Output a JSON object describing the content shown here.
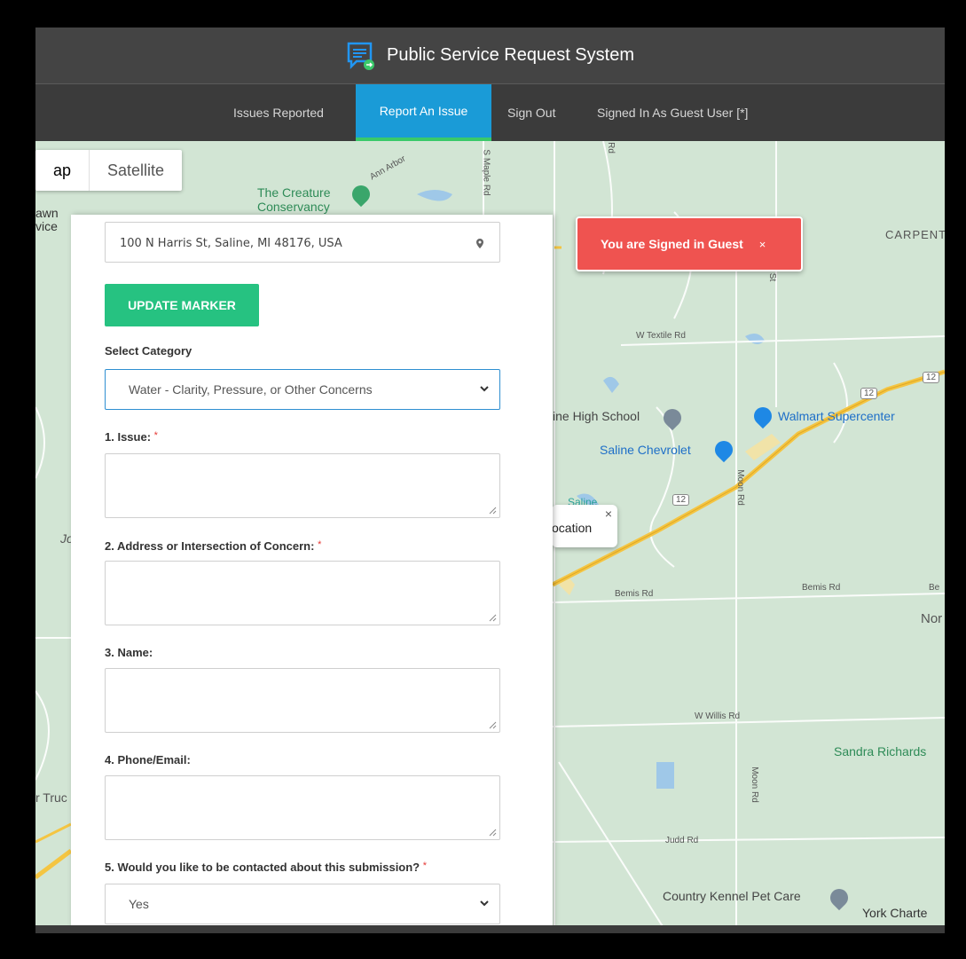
{
  "header": {
    "title": "Public Service Request System"
  },
  "nav": {
    "items": [
      {
        "label": "Issues Reported",
        "active": false
      },
      {
        "label": "Report An Issue",
        "active": true
      },
      {
        "label": "Sign Out",
        "active": false
      },
      {
        "label": "Signed In As Guest User [*]",
        "active": false
      }
    ]
  },
  "map": {
    "map_type": {
      "map": "ap",
      "satellite": "Satellite"
    },
    "labels": {
      "creature": "The Creature\nConservancy",
      "lawn": "awn",
      "vice": "vice",
      "carpenter": "CARPENT",
      "high_school": "ine High School",
      "walmart": "Walmart Supercenter",
      "chevrolet": "Saline Chevrolet",
      "joa": "Joa",
      "nor": "Nor",
      "sandra": "Sandra Richards",
      "truck": "r Truc",
      "kennel": "Country Kennel Pet Care",
      "york": "York Charte",
      "saline_small": "Saline"
    },
    "roads": {
      "ann_arbor": "Ann Arbor",
      "maple": "S Maple Rd",
      "w_textile": "W Textile Rd",
      "moon": "Moon Rd",
      "moon2": "Moon Rd",
      "bemis": "Bemis Rd",
      "bemis2": "Bemis Rd",
      "be": "Be",
      "willis": "W Willis Rd",
      "judd": "Judd Rd",
      "st": "St",
      "rd": "Rd",
      "r12a": "12",
      "r12b": "12",
      "r12c": "12"
    },
    "info_window": {
      "text": "ocation",
      "close": "×"
    }
  },
  "toast": {
    "message": "You are Signed in Guest",
    "close": "×"
  },
  "form": {
    "address_value": "100 N Harris St, Saline, MI 48176, USA",
    "update_button": "UPDATE MARKER",
    "category_label": "Select Category",
    "category_value": "Water - Clarity, Pressure, or Other Concerns",
    "issue_label": "1. Issue:",
    "address_label": "2. Address or Intersection of Concern:",
    "name_label": "3. Name:",
    "phone_label": "4. Phone/Email:",
    "contact_label": "5. Would you like to be contacted about this submission?",
    "contact_value": "Yes",
    "required_mark": "*"
  },
  "colors": {
    "header_bg": "#444444",
    "nav_bg": "#3b3b3b",
    "active_tab": "#1a9bd7",
    "active_underline": "#3ac96a",
    "update_button": "#26c281",
    "toast_bg": "#ef5350",
    "map_green": "#cde1cf"
  },
  "icons": {
    "logo": "chat-bubble-icon",
    "address": "map-pin-icon",
    "select": "chevron-down-icon"
  }
}
